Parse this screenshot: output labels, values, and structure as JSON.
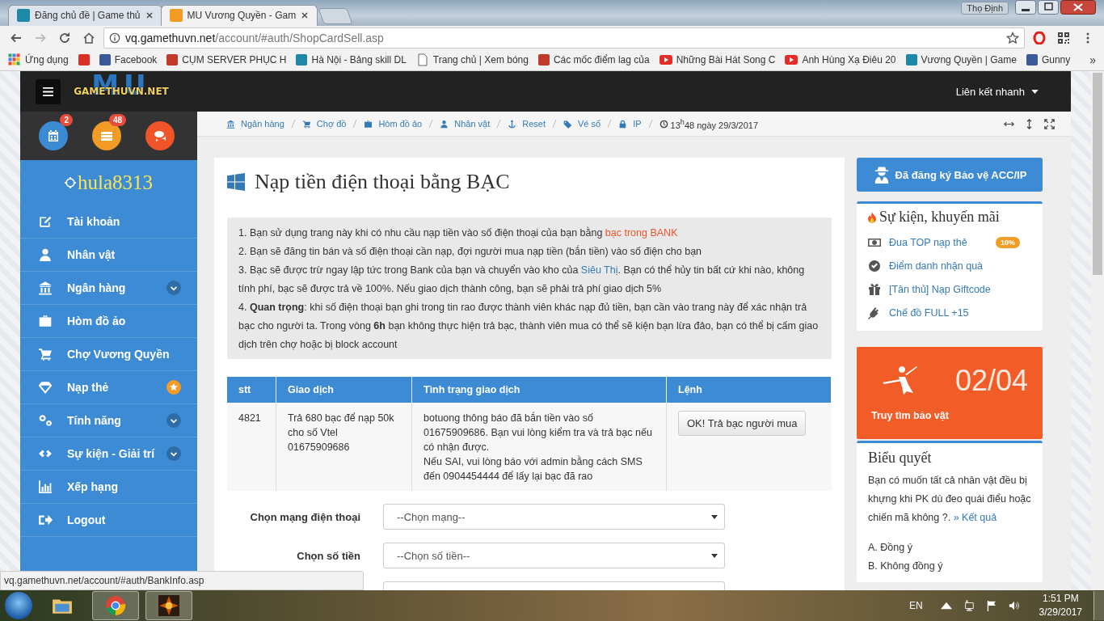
{
  "browser": {
    "tabs": [
      {
        "title": "Đăng chủ đề | Game thủ",
        "selected": false,
        "kind": "site"
      },
      {
        "title": "MU Vương Quyền - Gam",
        "selected": true,
        "kind": "crown"
      }
    ],
    "profile_name": "Thọ Định",
    "url": {
      "host": "vq.gamethuvn.net",
      "path": "/account/#auth/ShopCardSell.asp"
    },
    "bookmarks": [
      {
        "label": "Ứng dụng",
        "kind": "apps"
      },
      {
        "kind": "mail"
      },
      {
        "label": "Facebook",
        "kind": "facebook"
      },
      {
        "label": "CỤM SERVER PHỤC H",
        "kind": "game"
      },
      {
        "label": "Hà Nội - Bảng skill DL",
        "kind": "site"
      },
      {
        "label": "Trang chủ | Xem bóng",
        "kind": "page"
      },
      {
        "label": "Các mốc điểm lag của",
        "kind": "game"
      },
      {
        "label": "Những Bài Hát Song C",
        "kind": "video"
      },
      {
        "label": "Anh Hùng Xạ Điêu 20",
        "kind": "video"
      },
      {
        "label": "Vương Quyền | Game",
        "kind": "site"
      },
      {
        "label": "Gunny",
        "kind": "facebook"
      }
    ],
    "bookmarks_overflow": "»",
    "status_url": "vq.gamethuvn.net/account/#auth/BankInfo.asp"
  },
  "site": {
    "logo": {
      "mark": "MU",
      "text": "GAMETHUVN.NET"
    },
    "quick_links": "Liên kết nhanh",
    "shortcuts": [
      {
        "kind": "calendar",
        "color": "#3a8ad4",
        "badge": "2"
      },
      {
        "kind": "list",
        "color": "#f39c25",
        "badge": "48"
      },
      {
        "kind": "chat",
        "color": "#f0552a"
      }
    ],
    "username": "hula8313",
    "menu": [
      {
        "label": "Tài khoản",
        "kind": "pencil",
        "expandable": false,
        "featured": false
      },
      {
        "label": "Nhân vật",
        "kind": "person",
        "expandable": false,
        "featured": false
      },
      {
        "label": "Ngân hàng",
        "kind": "bank",
        "expandable": true,
        "featured": false
      },
      {
        "label": "Hòm đồ ảo",
        "kind": "briefcase",
        "expandable": false,
        "featured": false
      },
      {
        "label": "Chợ Vương Quyền",
        "kind": "cart",
        "expandable": false,
        "featured": false
      },
      {
        "label": "Nạp thẻ",
        "kind": "diamond",
        "expandable": false,
        "featured": true
      },
      {
        "label": "Tính năng",
        "kind": "gears",
        "expandable": true,
        "featured": false
      },
      {
        "label": "Sự kiện - Giải trí",
        "kind": "links",
        "expandable": true,
        "featured": false
      },
      {
        "label": "Xếp hạng",
        "kind": "chart",
        "expandable": false,
        "featured": false
      },
      {
        "label": "Logout",
        "kind": "exit",
        "expandable": false,
        "featured": false
      }
    ],
    "breadcrumb": [
      {
        "label": "Ngân hàng",
        "kind": "bank"
      },
      {
        "label": "Chợ đồ",
        "kind": "cart"
      },
      {
        "label": "Hòm đồ ảo",
        "kind": "briefcase"
      },
      {
        "label": "Nhân vật",
        "kind": "person"
      },
      {
        "label": "Reset",
        "kind": "anchor"
      },
      {
        "label": "Vé số",
        "kind": "tag"
      },
      {
        "label": "IP",
        "kind": "lock"
      }
    ],
    "datetime": "13$^{h}$48 ngày 29/3/2017"
  },
  "page": {
    "title": "Nạp tiền điện thoại bằng BẠC",
    "notes": [
      [
        {
          "kind": "text",
          "text": "1. Bạn sử dụng trang này khi có nhu cầu nạp tiền vào số điện thoại của bạn bằng "
        },
        {
          "kind": "highlight",
          "text": "bạc trong BANK"
        }
      ],
      [
        {
          "kind": "text",
          "text": "2. Bạn sẽ đăng tin bán và số điện thoại cần nạp, đợi người mua nạp tiền (bắn tiền) vào số điện cho bạn"
        }
      ],
      [
        {
          "kind": "text",
          "text": "3. Bạc sẽ được trừ ngay lập tức trong Bank của bạn và chuyển vào kho của "
        },
        {
          "kind": "link",
          "text": "Siêu Thị"
        },
        {
          "kind": "text",
          "text": ". Bạn có thể hủy tin bất cứ khi nào, không tính phí, bạc sẽ được trả về 100%. Nếu giao dịch thành công, bạn sẽ phải trả phí giao dịch 5%"
        }
      ],
      [
        {
          "kind": "text",
          "text": "4. **Quan trọng**: khi số điện thoại bạn ghi trong tin rao được thành viên khác nạp đủ tiền, bạn cần vào trang này để xác nhận trả bạc cho người ta. Trong vòng **6h** bạn không thực hiện trả bạc, thành viên mua có thể sẽ kiện bạn lừa đảo, bạn có thể bị cấm giao dịch trên chợ hoặc bị block account"
        }
      ]
    ],
    "table": {
      "columns": [
        "stt",
        "Giao dịch",
        "Tình trạng giao dịch",
        "Lệnh"
      ],
      "rows": [
        {
          "stt": "4821",
          "deal": "Trả 680 bạc để nạp 50k cho số Vtel 01675909686",
          "status": "botuong thông báo đã bắn tiền vào số 01675909686. Bạn vui lòng kiểm tra và trả bạc nếu có nhận được.\nNếu SAI, vui lòng báo với admin bằng cách SMS đến 0904454444 để lấy lại bạc đã rao",
          "action": "OK! Trả bạc người mua"
        }
      ]
    },
    "form": [
      {
        "label": "Chọn mạng điện thoại",
        "value": "--Chọn mạng--"
      },
      {
        "label": "Chọn số tiền",
        "value": "--Chọn số tiền--"
      }
    ]
  },
  "aside": {
    "protect_button": "Đã đăng ký Bảo vệ ACC/IP",
    "promo": {
      "title": "Sự kiện, khuyến mãi",
      "items": [
        {
          "label": "Đua TOP nạp thẻ",
          "kind": "money",
          "badge": "10%"
        },
        {
          "label": "Điểm danh nhận quà",
          "kind": "check"
        },
        {
          "label": "[Tân thủ] Nạp Giftcode",
          "kind": "gift"
        },
        {
          "label": "Chế đồ FULL +15",
          "kind": "plug"
        }
      ]
    },
    "treasure": {
      "count": "02/04",
      "label": "Truy tìm bảo vật"
    },
    "poll": {
      "title": "Biểu quyết",
      "question": "Bạn có muốn tất cả nhân vật đều bị khựng khi PK dù đeo quái điểu hoặc chiến mã không ?.",
      "result_link": "» Kết quả",
      "options": [
        "A. Đồng ý",
        "B. Không đồng ý"
      ]
    }
  },
  "taskbar": {
    "language": "EN",
    "time": "1:51 PM",
    "date": "3/29/2017",
    "apps": [
      {
        "kind": "folder"
      },
      {
        "kind": "browser"
      },
      {
        "kind": "game"
      }
    ]
  }
}
